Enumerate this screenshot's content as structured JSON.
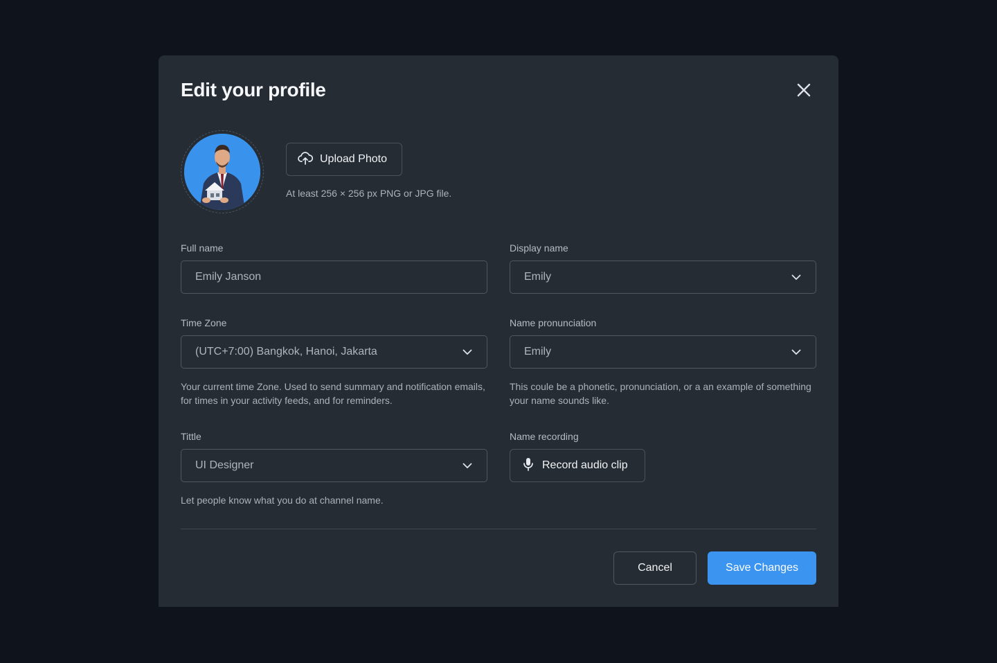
{
  "modal": {
    "title": "Edit your profile",
    "close_icon": "close-icon"
  },
  "photo": {
    "upload_label": "Upload Photo",
    "upload_icon": "cloud-upload-icon",
    "hint": "At least 256 × 256 px PNG or JPG file."
  },
  "fields": {
    "full_name": {
      "label": "Full name",
      "value": "Emily Janson"
    },
    "display_name": {
      "label": "Display name",
      "value": "Emily"
    },
    "time_zone": {
      "label": "Time Zone",
      "value": "(UTC+7:00) Bangkok, Hanoi, Jakarta",
      "help": "Your current time Zone. Used to send summary and notification emails, for times in your activity feeds, and for reminders."
    },
    "name_pronunciation": {
      "label": "Name pronunciation",
      "value": "Emily",
      "help": "This coule be a phonetic, pronunciation, or a an example of something your name sounds like."
    },
    "title": {
      "label": "Tittle",
      "value": "UI Designer",
      "help": "Let people know what you do at channel name."
    },
    "name_recording": {
      "label": "Name recording",
      "button_label": "Record audio clip",
      "icon": "microphone-icon"
    }
  },
  "actions": {
    "cancel_label": "Cancel",
    "save_label": "Save Changes"
  },
  "colors": {
    "background": "#0f131b",
    "modal": "#252c33",
    "accent": "#3b94f0"
  }
}
